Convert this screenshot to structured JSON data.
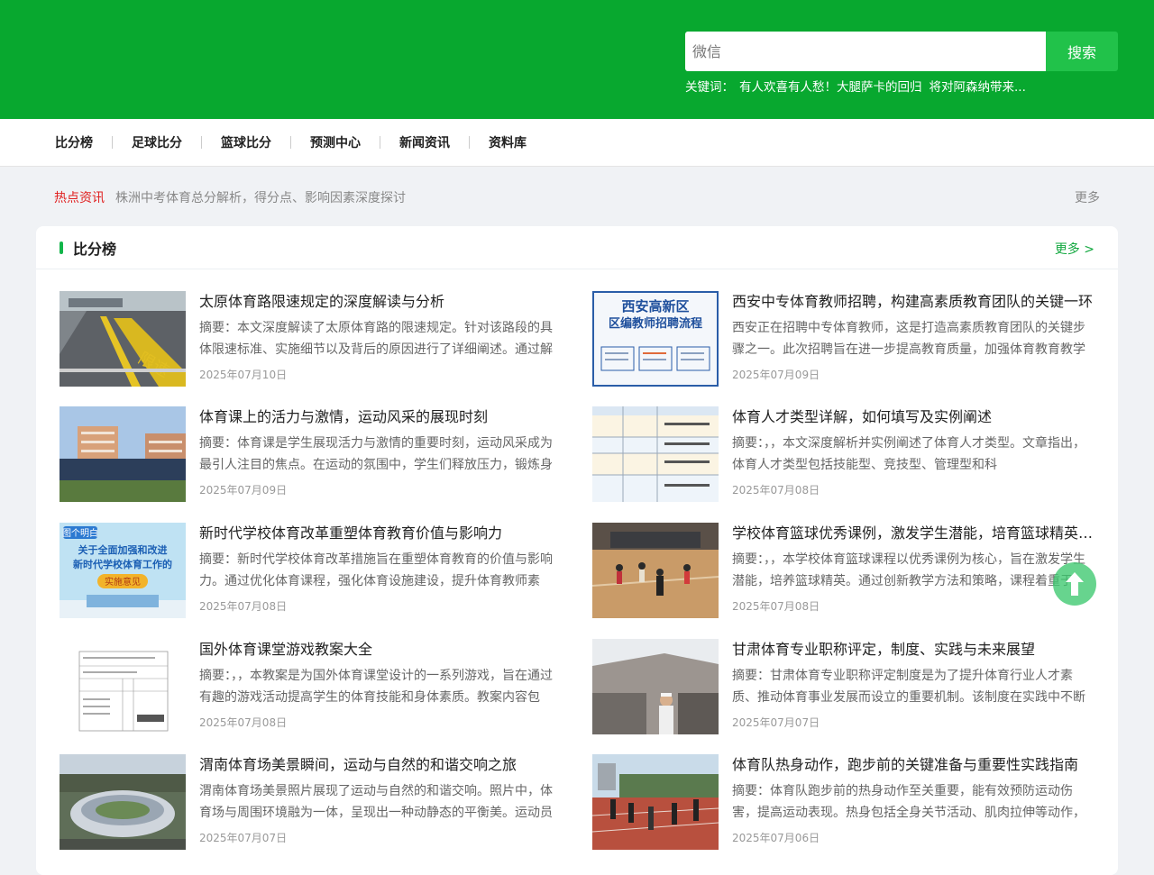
{
  "search": {
    "placeholder": "微信",
    "button_label": "搜索"
  },
  "keywords": {
    "label": "关键词：",
    "items": [
      "有人欢喜有人愁！大腿萨卡的回归",
      "将对阿森纳带来..."
    ]
  },
  "nav": {
    "items": [
      "比分榜",
      "足球比分",
      "篮球比分",
      "预测中心",
      "新闻资讯",
      "资料库"
    ]
  },
  "hot": {
    "label": "热点资讯",
    "text": "株洲中考体育总分解析，得分点、影响因素深度探讨",
    "more": "更多"
  },
  "section": {
    "title": "比分榜",
    "more": "更多 >"
  },
  "articles": [
    {
      "title": "太原体育路限速规定的深度解读与分析",
      "summary": "摘要：本文深度解读了太原体育路的限速规定。针对该路段的具体限速标准、实施细节以及背后的原因进行了详细阐述。通过解",
      "date": "2025年07月10日"
    },
    {
      "title": "西安中专体育教师招聘，构建高素质教育团队的关键一环",
      "summary": "西安正在招聘中专体育教师，这是打造高素质教育团队的关键步骤之一。此次招聘旨在进一步提高教育质量，加强体育教育教学",
      "date": "2025年07月09日",
      "thumb_heading": [
        "西安高新区",
        "区编教师招聘流程"
      ]
    },
    {
      "title": "体育课上的活力与激情，运动风采的展现时刻",
      "summary": "摘要：体育课是学生展现活力与激情的重要时刻，运动风采成为最引人注目的焦点。在运动的氛围中，学生们释放压力，锻炼身",
      "date": "2025年07月09日"
    },
    {
      "title": "体育人才类型详解，如何填写及实例阐述",
      "summary": "摘要：，，本文深度解析并实例阐述了体育人才类型。文章指出，体育人才类型包括技能型、竞技型、管理型和科",
      "date": "2025年07月08日"
    },
    {
      "title": "新时代学校体育改革重塑体育教育价值与影响力",
      "summary": "摘要：新时代学校体育改革措施旨在重塑体育教育的价值与影响力。通过优化体育课程，强化体育设施建设，提升体育教师素",
      "date": "2025年07月08日",
      "thumb_heading": [
        "图个明白",
        "关于全面加强和改进",
        "新时代学校体育工作的",
        "实施意见"
      ]
    },
    {
      "title": "学校体育篮球优秀课例，激发学生潜能，培育篮球精英的教学实践",
      "summary": "摘要：，，本学校体育篮球课程以优秀课例为核心，旨在激发学生潜能，培养篮球精英。通过创新教学方法和策略，课程着重于",
      "date": "2025年07月08日"
    },
    {
      "title": "国外体育课堂游戏教案大全",
      "summary": "摘要：，，本教案是为国外体育课堂设计的一系列游戏，旨在通过有趣的游戏活动提高学生的体育技能和身体素质。教案内容包",
      "date": "2025年07月08日"
    },
    {
      "title": "甘肃体育专业职称评定，制度、实践与未来展望",
      "summary": "摘要：甘肃体育专业职称评定制度是为了提升体育行业人才素质、推动体育事业发展而设立的重要机制。该制度在实践中不断",
      "date": "2025年07月07日"
    },
    {
      "title": "渭南体育场美景瞬间，运动与自然的和谐交响之旅",
      "summary": "渭南体育场美景照片展现了运动与自然的和谐交响。照片中，体育场与周围环境融为一体，呈现出一种动静态的平衡美。运动员",
      "date": "2025年07月07日"
    },
    {
      "title": "体育队热身动作，跑步前的关键准备与重要性实践指南",
      "summary": "摘要：体育队跑步前的热身动作至关重要，能有效预防运动伤害，提高运动表现。热身包括全身关节活动、肌肉拉伸等动作，",
      "date": "2025年07月06日"
    }
  ]
}
